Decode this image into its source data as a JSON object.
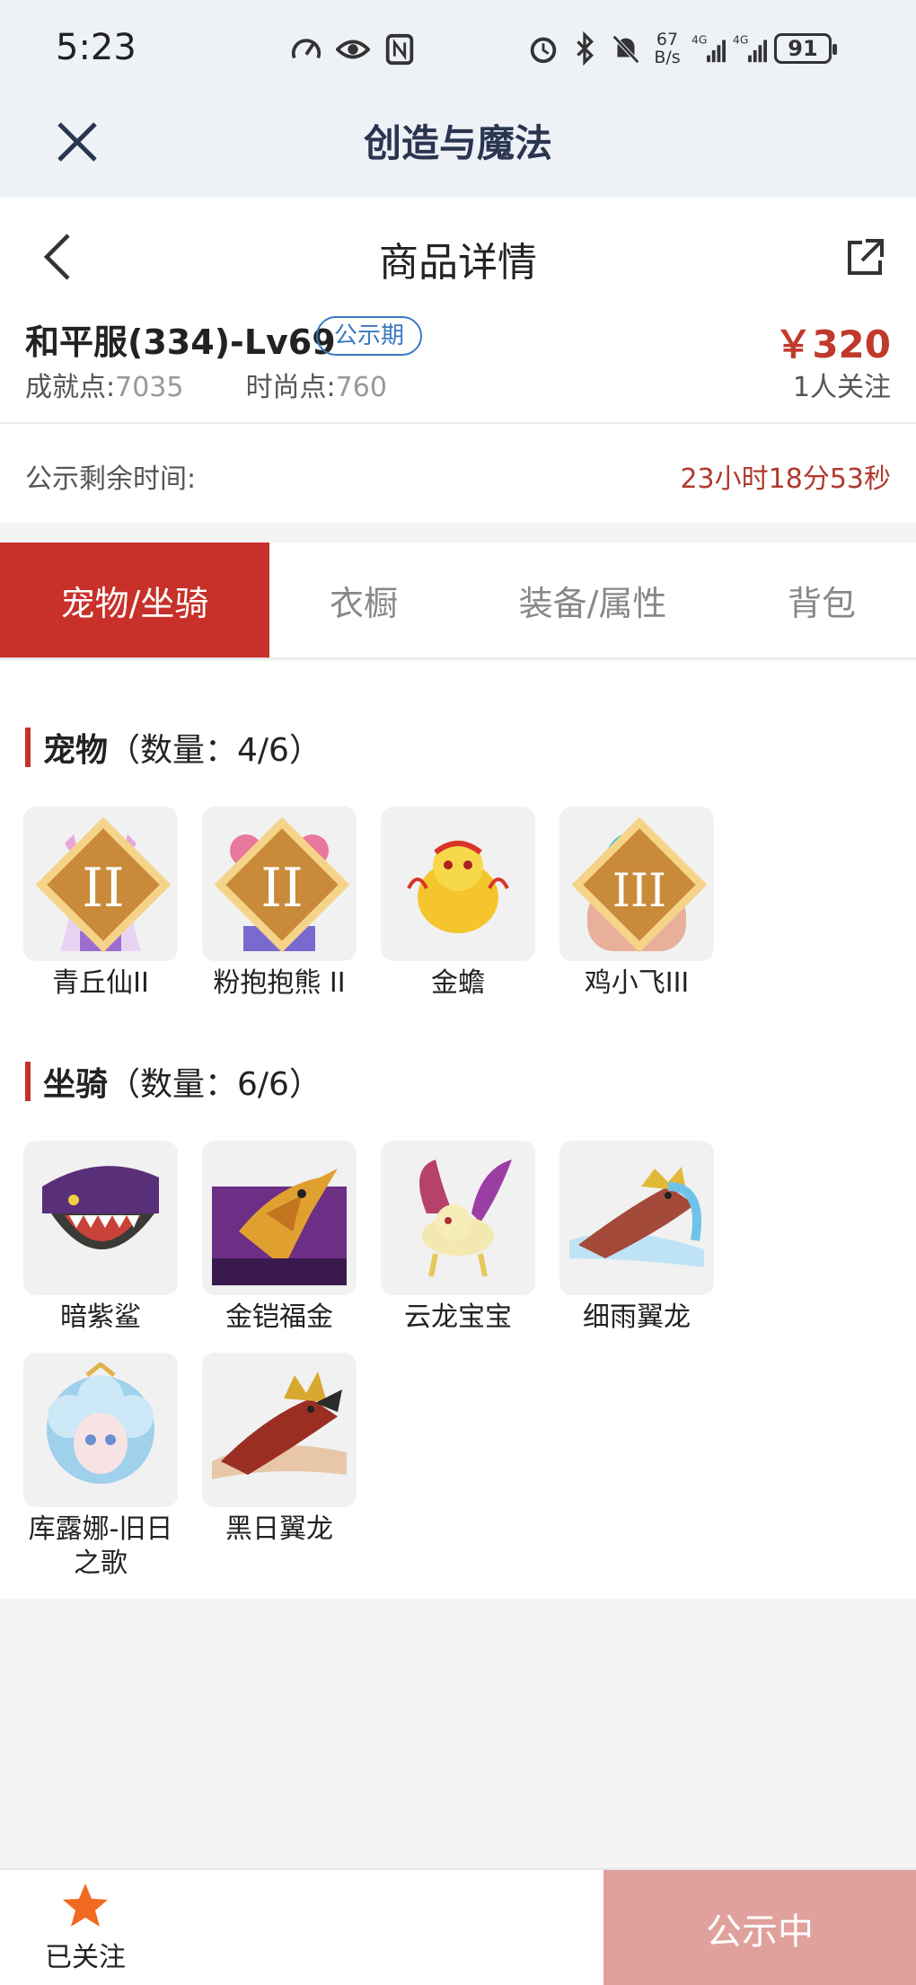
{
  "status_bar": {
    "time": "5:23",
    "net_speed": "67 B/s",
    "net_speed_top": "67",
    "net_speed_bottom": "B/s",
    "signal1": "4G",
    "signal2": "4G",
    "battery": "91"
  },
  "app": {
    "title": "创造与魔法"
  },
  "page": {
    "title": "商品详情"
  },
  "product": {
    "server": "和平服(334)-Lv69",
    "badge": "公示期",
    "achievement_label": "成就点:",
    "achievement_value": "7035",
    "fashion_label": "时尚点:",
    "fashion_value": "760",
    "price": "￥320",
    "followers": "1人关注"
  },
  "timer": {
    "label": "公示剩余时间:",
    "value": "23小时18分53秒"
  },
  "tabs": [
    {
      "label": "宠物/坐骑",
      "active": true
    },
    {
      "label": "衣橱",
      "active": false
    },
    {
      "label": "装备/属性",
      "active": false
    },
    {
      "label": "背包",
      "active": false
    }
  ],
  "pets": {
    "title": "宠物",
    "count": "（数量：4/6）",
    "items": [
      {
        "name": "青丘仙II",
        "rank": "II",
        "icon": "fox-fairy-icon"
      },
      {
        "name": "粉抱抱熊 II",
        "rank": "II",
        "icon": "pink-bear-icon"
      },
      {
        "name": "金蟾",
        "rank": "",
        "icon": "golden-toad-icon"
      },
      {
        "name": "鸡小飞III",
        "rank": "III",
        "icon": "chicken-icon"
      }
    ]
  },
  "mounts": {
    "title": "坐骑",
    "count": "（数量：6/6）",
    "items": [
      {
        "name": "暗紫鲨",
        "icon": "purple-shark-icon"
      },
      {
        "name": "金铠福金",
        "icon": "golden-armor-dragon-icon"
      },
      {
        "name": "云龙宝宝",
        "icon": "cloud-dragon-icon"
      },
      {
        "name": "细雨翼龙",
        "icon": "rain-pterosaur-icon"
      },
      {
        "name": "库露娜-旧日之歌",
        "icon": "kuluna-icon"
      },
      {
        "name": "黑日翼龙",
        "icon": "black-sun-pterosaur-icon"
      }
    ]
  },
  "bottom": {
    "follow_label": "已关注",
    "status": "公示中"
  },
  "colors": {
    "accent": "#c8302a",
    "badge": "#3a78c2",
    "status_button": "#e0a19c"
  }
}
